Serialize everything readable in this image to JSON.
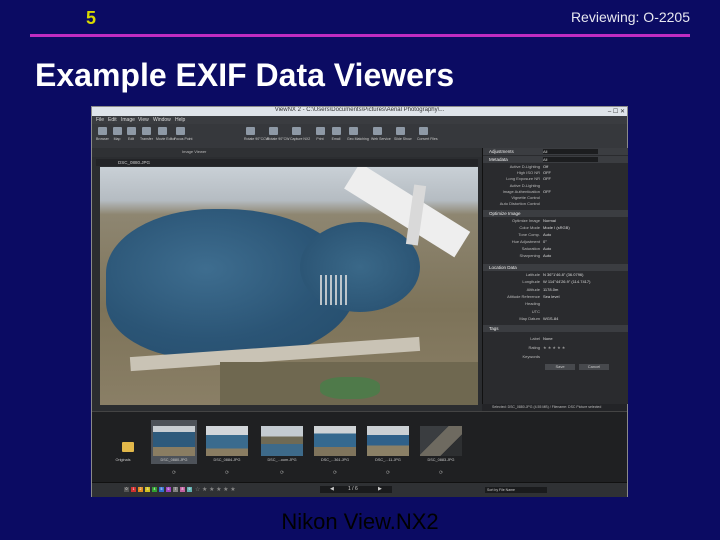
{
  "slide": {
    "number": "5",
    "reviewing": "Reviewing: O-2205",
    "title": "Example EXIF Data Viewers",
    "caption": "Nikon View.NX2",
    "accent_color": "#c02dc0",
    "number_color": "#d8d800",
    "background_color": "#0b0b63"
  },
  "app": {
    "window_title": "ViewNX 2 - C:\\Users\\Documents\\Pictures\\Aerial Photography\\...",
    "window_controls": "–  ☐  ✕",
    "menu": [
      "File",
      "Edit",
      "Image",
      "View",
      "Window",
      "Help"
    ],
    "toolbar": [
      "Browser",
      "Map",
      "Edit",
      "Transfer",
      "Movie Editor",
      "Focus Point",
      "Rotate 90°CCW",
      "Rotate 90°CW",
      "Capture NX2",
      "Print",
      "Email",
      "Geo Matching",
      "Web Service",
      "Slide Show",
      "Convert Files"
    ],
    "viewer_label": "Image Viewer",
    "current_file": "DSC_0880.JPG",
    "panel": {
      "adjustments_header": "Adjustments",
      "all_label": "All",
      "metadata_header": "Metadata",
      "metadata_rows": [
        {
          "k": "Active D-Lighting",
          "v": "Off"
        },
        {
          "k": "High ISO NR",
          "v": "OFF"
        },
        {
          "k": "Long Exposure NR",
          "v": "OFF"
        },
        {
          "k": "Active D-Lighting",
          "v": ""
        },
        {
          "k": "Image Authentication",
          "v": "OFF"
        },
        {
          "k": "Vignette Control",
          "v": ""
        },
        {
          "k": "Auto Distortion Control",
          "v": ""
        }
      ],
      "optimize_header": "Optimize Image",
      "optimize_rows": [
        {
          "k": "Optimize Image",
          "v": "Normal"
        },
        {
          "k": "Color Mode",
          "v": "Mode I (sRGB)"
        },
        {
          "k": "Tone Comp.",
          "v": "Auto"
        },
        {
          "k": "Hue Adjustment",
          "v": "0°"
        },
        {
          "k": "Saturation",
          "v": "Auto"
        },
        {
          "k": "Sharpening",
          "v": "Auto"
        }
      ],
      "location_header": "Location Data",
      "location_rows": [
        {
          "k": "Latitude",
          "v": "N 36°1'46.8\" (36.0796)"
        },
        {
          "k": "Longitude",
          "v": "W 114°44'26.9\" (114.7417)"
        },
        {
          "k": "Altitude",
          "v": "1178.0m"
        },
        {
          "k": "Altitude Reference",
          "v": "Sea level"
        },
        {
          "k": "Heading",
          "v": ""
        },
        {
          "k": "UTC",
          "v": ""
        },
        {
          "k": "Map Datum",
          "v": "WGS-84"
        }
      ],
      "tags_header": "Tags",
      "label_key": "Label",
      "label_value": "None",
      "rating_key": "Rating",
      "rating_stars": "★ ★ ★ ★ ★",
      "keywords_key": "Keywords",
      "save_button": "Save",
      "cancel_button": "Cancel"
    },
    "status_text": "Selected: DSC_0880.JPG (4.55 MB) / Filename: DSC Picture selected",
    "filmstrip": [
      {
        "caption": "Originals",
        "kind": "folder"
      },
      {
        "caption": "DSC_0880.JPG",
        "kind": "photo",
        "selected": true
      },
      {
        "caption": "DSC_0884.JPG",
        "kind": "photo"
      },
      {
        "caption": "DSC_...oom.JPG",
        "kind": "photo"
      },
      {
        "caption": "DSC_...361.JPG",
        "kind": "photo"
      },
      {
        "caption": "DSC_...11.JPG",
        "kind": "photo"
      },
      {
        "caption": "DSC_0883.JPG",
        "kind": "photo"
      }
    ],
    "label_numbers": [
      "0",
      "1",
      "2",
      "3",
      "4",
      "5",
      "6",
      "7",
      "8",
      "9"
    ],
    "label_colors": [
      "#555555",
      "#d03030",
      "#e08a20",
      "#d0c020",
      "#30a030",
      "#3070d0",
      "#a040c0",
      "#808080",
      "#c060a0",
      "#60b0b0"
    ],
    "rating_bar": "☆ ★ ★ ★ ★ ★",
    "pager_text": "1 / 6",
    "sort_select": "Sort by File Name"
  }
}
